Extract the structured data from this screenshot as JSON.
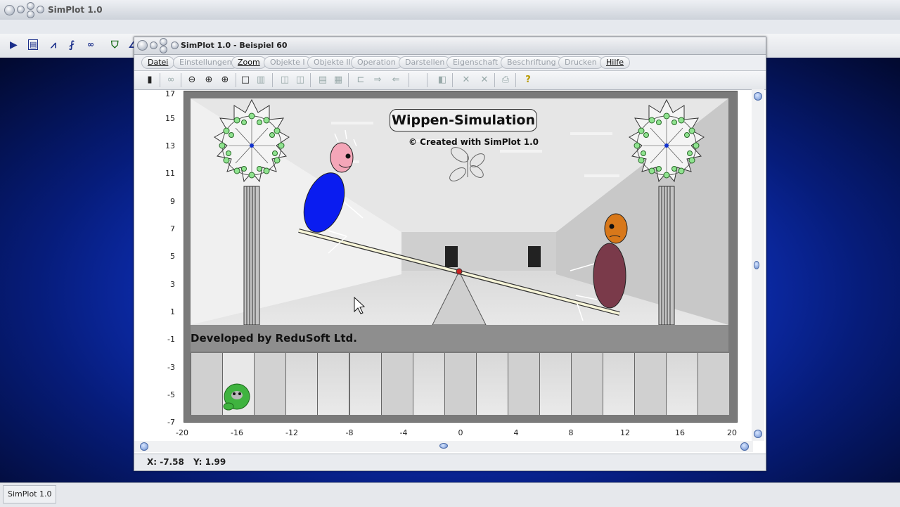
{
  "outer": {
    "title": "SimPlot 1.0",
    "taskbar_label": "SimPlot 1.0"
  },
  "window": {
    "title": "SimPlot 1.0 - Beispiel 60"
  },
  "menu": [
    {
      "label": "Datei",
      "enabled": true
    },
    {
      "label": "Einstellungen",
      "enabled": false
    },
    {
      "label": "Zoom",
      "enabled": true
    },
    {
      "label": "Objekte I",
      "enabled": false
    },
    {
      "label": "Objekte II",
      "enabled": false
    },
    {
      "label": "Operation",
      "enabled": false
    },
    {
      "label": "Darstellen",
      "enabled": false
    },
    {
      "label": "Eigenschaft",
      "enabled": false
    },
    {
      "label": "Beschriftung",
      "enabled": false
    },
    {
      "label": "Drucken",
      "enabled": false
    },
    {
      "label": "Hilfe",
      "enabled": true
    }
  ],
  "plot": {
    "y_ticks": [
      "17",
      "15",
      "13",
      "11",
      "9",
      "7",
      "5",
      "3",
      "1",
      "-1",
      "-3",
      "-5",
      "-7"
    ],
    "x_ticks": [
      "-20",
      "-16",
      "-12",
      "-8",
      "-4",
      "0",
      "4",
      "8",
      "12",
      "16",
      "20"
    ],
    "scene_title": "Wippen-Simulation",
    "copyright": "© Created with SimPlot 1.0",
    "developer": "Developed by ReduSoft Ltd."
  },
  "coords": {
    "x": "X: -7.58",
    "y": "Y: 1.99"
  },
  "colors": {
    "desktop": "#1137d0",
    "left_body": "#0a1cf0",
    "left_head": "#f4a6b8",
    "right_body": "#7a3a4a",
    "right_head": "#d8781a",
    "pivot": "#cc2222"
  }
}
